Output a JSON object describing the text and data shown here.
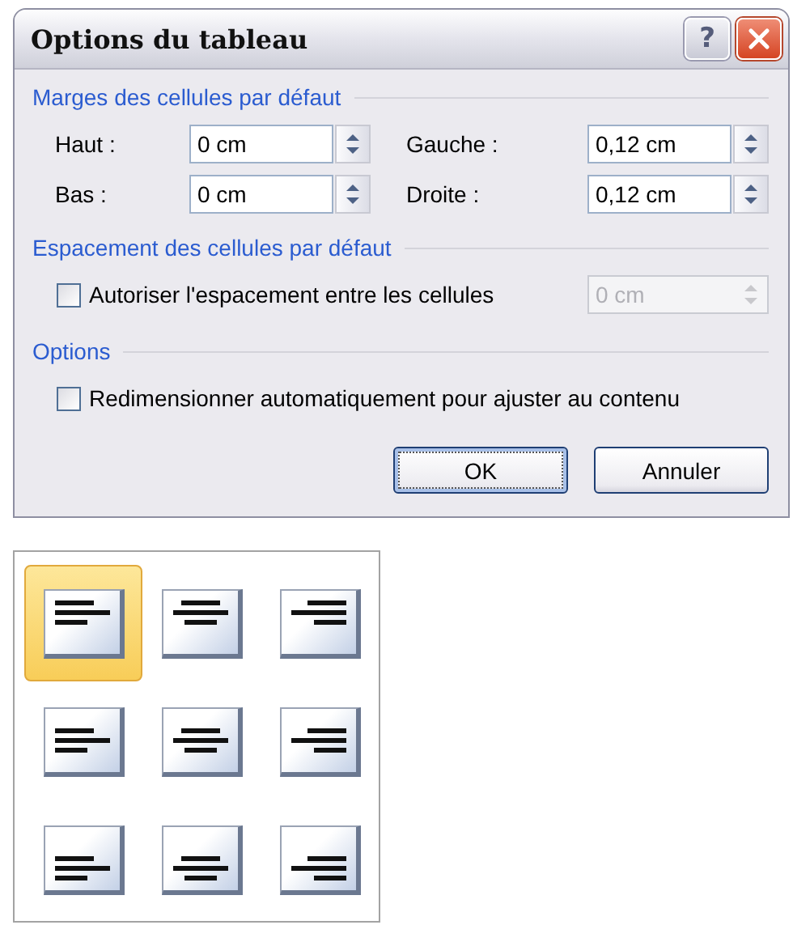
{
  "window": {
    "title": "Options du tableau",
    "title_buttons": [
      {
        "kind": "help",
        "label": "?"
      },
      {
        "kind": "close"
      }
    ]
  },
  "groups": [
    {
      "kind": "margins",
      "title": "Marges des cellules par défaut",
      "fields": [
        {
          "label": "Haut :",
          "value": "0 cm"
        },
        {
          "label": "Gauche :",
          "value": "0,12 cm"
        },
        {
          "label": "Bas :",
          "value": "0 cm"
        },
        {
          "label": "Droite :",
          "value": "0,12 cm"
        }
      ]
    },
    {
      "kind": "spacing",
      "title": "Espacement des cellules par défaut",
      "checkbox": {
        "label": "Autoriser l'espacement entre les cellules",
        "checked": false
      },
      "field": {
        "value": "0 cm",
        "disabled": true
      }
    },
    {
      "kind": "options",
      "title": "Options",
      "checkbox": {
        "label": "Redimensionner automatiquement pour ajuster au contenu",
        "checked": false
      }
    }
  ],
  "buttons": [
    {
      "label": "OK",
      "default": true
    },
    {
      "label": "Annuler",
      "default": false
    }
  ],
  "alignment_palette": {
    "cells": [
      {
        "kind": "top_left",
        "selected": true
      },
      {
        "kind": "top_center",
        "selected": false
      },
      {
        "kind": "top_right",
        "selected": false
      },
      {
        "kind": "middle_left",
        "selected": false
      },
      {
        "kind": "middle_center",
        "selected": false
      },
      {
        "kind": "middle_right",
        "selected": false
      },
      {
        "kind": "bottom_left",
        "selected": false
      },
      {
        "kind": "bottom_center",
        "selected": false
      },
      {
        "kind": "bottom_right",
        "selected": false
      }
    ]
  }
}
